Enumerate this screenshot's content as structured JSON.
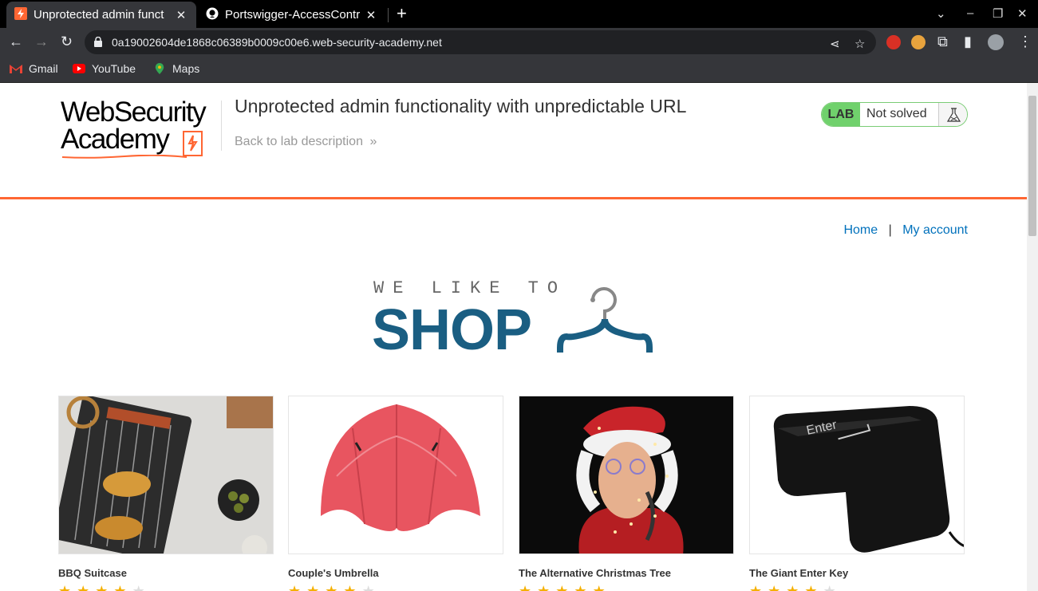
{
  "browser": {
    "tabs": [
      {
        "title": "Unprotected admin funct",
        "active": true,
        "icon": "burp-lightning-icon"
      },
      {
        "title": "Portswigger-AccessContr",
        "active": false,
        "icon": "github-icon"
      }
    ],
    "url": "0a19002604de1868c06389b0009c00e6.web-security-academy.net",
    "bookmarks": [
      {
        "label": "Gmail",
        "icon": "gmail-icon"
      },
      {
        "label": "YouTube",
        "icon": "youtube-icon"
      },
      {
        "label": "Maps",
        "icon": "maps-icon"
      }
    ]
  },
  "lab": {
    "logo_line1": "WebSecurity",
    "logo_line2": "Academy",
    "title": "Unprotected admin functionality with unpredictable URL",
    "back_link": "Back to lab description",
    "badge": "LAB",
    "status": "Not solved"
  },
  "nav": {
    "home": "Home",
    "separator": "|",
    "account": "My account"
  },
  "shop": {
    "tagline": "WE LIKE TO",
    "title": "SHOP"
  },
  "products": [
    {
      "name": "BBQ Suitcase",
      "rating": 4
    },
    {
      "name": "Couple's Umbrella",
      "rating": 4
    },
    {
      "name": "The Alternative Christmas Tree",
      "rating": 5
    },
    {
      "name": "The Giant Enter Key",
      "rating": 4
    }
  ],
  "colors": {
    "accent_orange": "#ff6633",
    "link_blue": "#0071bc",
    "lab_green": "#70d16c",
    "shop_blue": "#1a5e82",
    "star_gold": "#f5b000"
  }
}
